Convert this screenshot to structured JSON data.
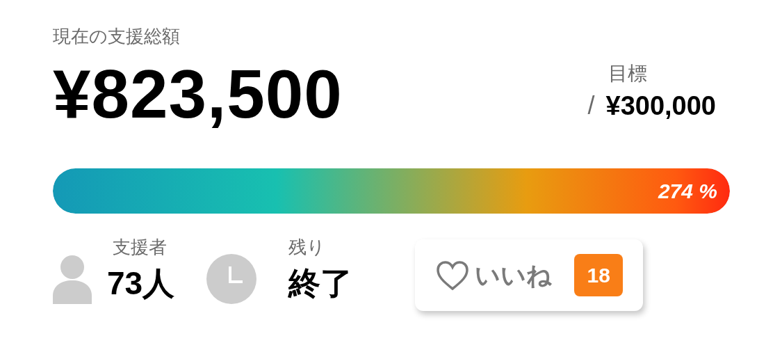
{
  "total_label": "現在の支援総額",
  "total_amount": "¥823,500",
  "goal": {
    "label": "目標",
    "separator": "/",
    "amount": "¥300,000"
  },
  "progress": {
    "level": 1,
    "percent": "274 %"
  },
  "stats": [
    {
      "kind": "supporters",
      "label": "支援者",
      "value": "73人"
    },
    {
      "kind": "remaining",
      "label": "残り",
      "value": "終了"
    }
  ],
  "like_button": {
    "label": "いいね",
    "count": "18",
    "liked": false
  }
}
